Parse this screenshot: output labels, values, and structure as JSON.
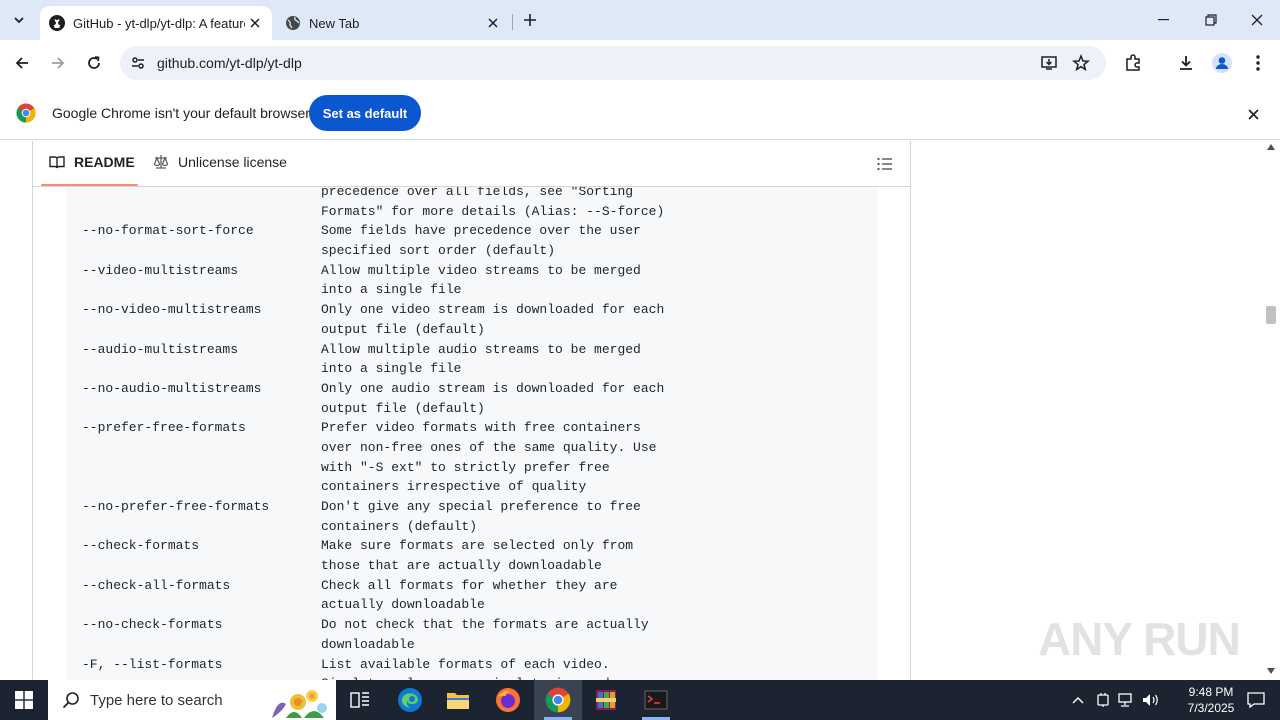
{
  "browser": {
    "tabs": [
      {
        "title": "GitHub - yt-dlp/yt-dlp: A feature-rich command-line audio/video downloader",
        "active": true
      },
      {
        "title": "New Tab",
        "active": false
      }
    ],
    "url": "github.com/yt-dlp/yt-dlp"
  },
  "infobar": {
    "message": "Google Chrome isn't your default browser",
    "button_label": "Set as default"
  },
  "readme": {
    "tab_readme": "README",
    "tab_license": "Unlicense license"
  },
  "code_lines": [
    {
      "opt": "",
      "desc": "precedence over all fields, see \"Sorting"
    },
    {
      "opt": "",
      "desc": "Formats\" for more details (Alias: --S-force)"
    },
    {
      "opt": "--no-format-sort-force",
      "desc": "Some fields have precedence over the user"
    },
    {
      "opt": "",
      "desc": "specified sort order (default)"
    },
    {
      "opt": "--video-multistreams",
      "desc": "Allow multiple video streams to be merged"
    },
    {
      "opt": "",
      "desc": "into a single file"
    },
    {
      "opt": "--no-video-multistreams",
      "desc": "Only one video stream is downloaded for each"
    },
    {
      "opt": "",
      "desc": "output file (default)"
    },
    {
      "opt": "--audio-multistreams",
      "desc": "Allow multiple audio streams to be merged"
    },
    {
      "opt": "",
      "desc": "into a single file"
    },
    {
      "opt": "--no-audio-multistreams",
      "desc": "Only one audio stream is downloaded for each"
    },
    {
      "opt": "",
      "desc": "output file (default)"
    },
    {
      "opt": "--prefer-free-formats",
      "desc": "Prefer video formats with free containers"
    },
    {
      "opt": "",
      "desc": "over non-free ones of the same quality. Use"
    },
    {
      "opt": "",
      "desc": "with \"-S ext\" to strictly prefer free"
    },
    {
      "opt": "",
      "desc": "containers irrespective of quality"
    },
    {
      "opt": "--no-prefer-free-formats",
      "desc": "Don't give any special preference to free"
    },
    {
      "opt": "",
      "desc": "containers (default)"
    },
    {
      "opt": "--check-formats",
      "desc": "Make sure formats are selected only from"
    },
    {
      "opt": "",
      "desc": "those that are actually downloadable"
    },
    {
      "opt": "--check-all-formats",
      "desc": "Check all formats for whether they are"
    },
    {
      "opt": "",
      "desc": "actually downloadable"
    },
    {
      "opt": "--no-check-formats",
      "desc": "Do not check that the formats are actually"
    },
    {
      "opt": "",
      "desc": "downloadable"
    },
    {
      "opt": "-F, --list-formats",
      "desc": "List available formats of each video."
    },
    {
      "opt": "",
      "desc": "Simulate unless --no-simulate is used"
    }
  ],
  "watermark": "ANY RUN",
  "taskbar": {
    "search_placeholder": "Type here to search",
    "time": "9:48 PM",
    "date": "7/3/2025"
  },
  "colors": {
    "accent_blue": "#0b57d0",
    "tab_strip": "#dfe8f7",
    "readme_underline": "#fd8c73",
    "taskbar": "#1c2431"
  }
}
